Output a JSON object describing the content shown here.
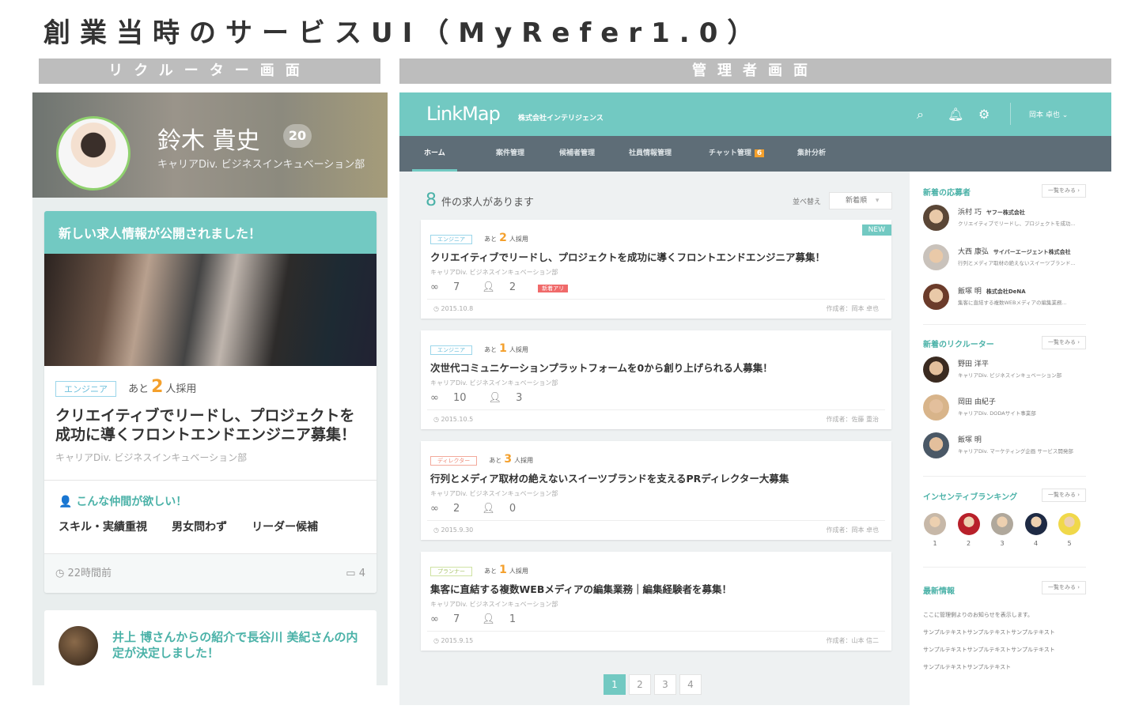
{
  "slide_title": "創業当時のサービスUI（MyRefer1.0）",
  "labels": {
    "recruiter": "リクルーター画面",
    "admin": "管理者画面"
  },
  "recruiter": {
    "user": {
      "name": "鈴木 貴史",
      "badge": "20",
      "dept": "キャリアDiv. ビジネスインキュベーション部"
    },
    "card": {
      "header": "新しい求人情報が公開されました！",
      "tag": "エンジニア",
      "remain_prefix": "あと",
      "remain": "2",
      "remain_suffix": "人採用",
      "title": "クリエイティブでリードし、プロジェクトを成功に導くフロントエンドエンジニア募集！",
      "dept": "キャリアDiv. ビジネスインキュベーション部",
      "want_heading": "こんな仲間が欲しい！",
      "skills": [
        "スキル・実績重視",
        "男女問わず",
        "リーダー候補"
      ],
      "time": "22時間前",
      "comments": "4"
    },
    "notice": "井上 博さんからの紹介で長谷川 美紀さんの内定が決定しました！"
  },
  "admin": {
    "logo": "LinkMap",
    "company": "株式会社インテリジェンス",
    "user": "岡本 卓也",
    "nav": [
      {
        "label": "ホーム"
      },
      {
        "label": "案件管理"
      },
      {
        "label": "候補者管理"
      },
      {
        "label": "社員情報管理"
      },
      {
        "label": "チャット管理",
        "badge": "6"
      },
      {
        "label": "集計分析"
      }
    ],
    "count": "8",
    "count_suffix": "件の求人があります",
    "sort_label": "並べ替え",
    "sort_value": "新着順",
    "jobs": [
      {
        "tag": "エンジニア",
        "remain": "2",
        "title": "クリエイティブでリードし、プロジェクトを成功に導くフロントエンドエンジニア募集！",
        "dept": "キャリアDiv. ビジネスインキュベーション部",
        "referrals": "7",
        "candidates": "2",
        "hot": "新着アリ",
        "new": "NEW",
        "date": "2015.10.8",
        "author": "作成者：岡本 卓也"
      },
      {
        "tag": "エンジニア",
        "remain": "1",
        "title": "次世代コミュニケーションプラットフォームを0から創り上げられる人募集！",
        "dept": "キャリアDiv. ビジネスインキュベーション部",
        "referrals": "10",
        "candidates": "3",
        "date": "2015.10.5",
        "author": "作成者：佐藤 重治"
      },
      {
        "tag": "ディレクター",
        "remain": "3",
        "title": "行列とメディア取材の絶えないスイーツブランドを支えるPRディレクター大募集",
        "dept": "キャリアDiv. ビジネスインキュベーション部",
        "referrals": "2",
        "candidates": "0",
        "date": "2015.9.30",
        "author": "作成者：岡本 卓也"
      },
      {
        "tag": "プランナー",
        "remain": "1",
        "title": "集客に直結する複数WEBメディアの編集業務｜編集経験者を募集！",
        "dept": "キャリアDiv. ビジネスインキュベーション部",
        "referrals": "7",
        "candidates": "1",
        "date": "2015.9.15",
        "author": "作成者：山本 信二"
      }
    ],
    "remain_prefix": "あと",
    "remain_suffix": "人採用",
    "pages": [
      "1",
      "2",
      "3",
      "4"
    ],
    "sidebar": {
      "more": "一覧をみる",
      "applicants_title": "新着の応募者",
      "applicants": [
        {
          "name": "浜村 巧",
          "company": "ヤフー株式会社",
          "desc": "クリエイティブでリードし、プロジェクトを成功..."
        },
        {
          "name": "大西 康弘",
          "company": "サイバーエージェント株式会社",
          "desc": "行列とメディア取材の絶えないスイーツブランド..."
        },
        {
          "name": "飯塚 明",
          "company": "株式会社DeNA",
          "desc": "集客に直結する複数WEBメディアの編集業務..."
        }
      ],
      "recruiters_title": "新着のリクルーター",
      "recruiters": [
        {
          "name": "野田 洋平",
          "desc": "キャリアDiv. ビジネスインキュベーション部"
        },
        {
          "name": "岡田 由紀子",
          "desc": "キャリアDiv. DODAサイト事業部"
        },
        {
          "name": "飯塚 明",
          "desc": "キャリアDiv. マーケティング企画 サービス開発部"
        }
      ],
      "ranking_title": "インセンティブランキング",
      "ranking": [
        "1",
        "2",
        "3",
        "4",
        "5"
      ],
      "news_title": "最新情報",
      "news": [
        "ここに管理側よりのお知らせを表示します。",
        "サンプルテキストサンプルテキストサンプルテキスト",
        "サンプルテキストサンプルテキストサンプルテキスト",
        "サンプルテキストサンプルテキスト"
      ]
    }
  },
  "colors": {
    "teal": "#72c9c2",
    "nav": "#5e6d77",
    "orange": "#f4a02c"
  }
}
